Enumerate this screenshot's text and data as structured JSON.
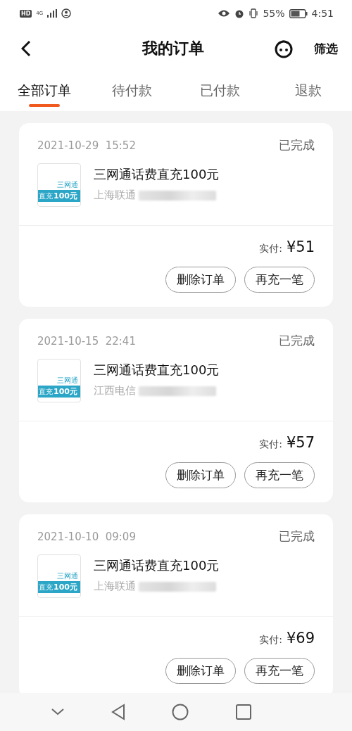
{
  "status_bar": {
    "hd": "HD",
    "network": "4G",
    "battery": "55%",
    "time": "4:51"
  },
  "header": {
    "title": "我的订单",
    "filter": "筛选"
  },
  "tabs": [
    {
      "label": "全部订单",
      "selected": true
    },
    {
      "label": "待付款",
      "selected": false
    },
    {
      "label": "已付款",
      "selected": false
    },
    {
      "label": "退款",
      "selected": false
    }
  ],
  "orders": [
    {
      "date": "2021-10-29  15:52",
      "status": "已完成",
      "thumb_title": "三网通",
      "thumb_badge_prefix": "直充",
      "thumb_badge_amount": "100元",
      "product": "三网通话费直充100元",
      "carrier": "上海联通",
      "paid_label": "实付:",
      "paid": "¥51",
      "buttons": [
        "删除订单",
        "再充一笔"
      ]
    },
    {
      "date": "2021-10-15  22:41",
      "status": "已完成",
      "thumb_title": "三网通",
      "thumb_badge_prefix": "直充",
      "thumb_badge_amount": "100元",
      "product": "三网通话费直充100元",
      "carrier": "江西电信",
      "paid_label": "实付:",
      "paid": "¥57",
      "buttons": [
        "删除订单",
        "再充一笔"
      ]
    },
    {
      "date": "2021-10-10  09:09",
      "status": "已完成",
      "thumb_title": "三网通",
      "thumb_badge_prefix": "直充",
      "thumb_badge_amount": "100元",
      "product": "三网通话费直充100元",
      "carrier": "上海联通",
      "paid_label": "实付:",
      "paid": "¥69",
      "buttons": [
        "删除订单",
        "再充一笔"
      ]
    }
  ]
}
